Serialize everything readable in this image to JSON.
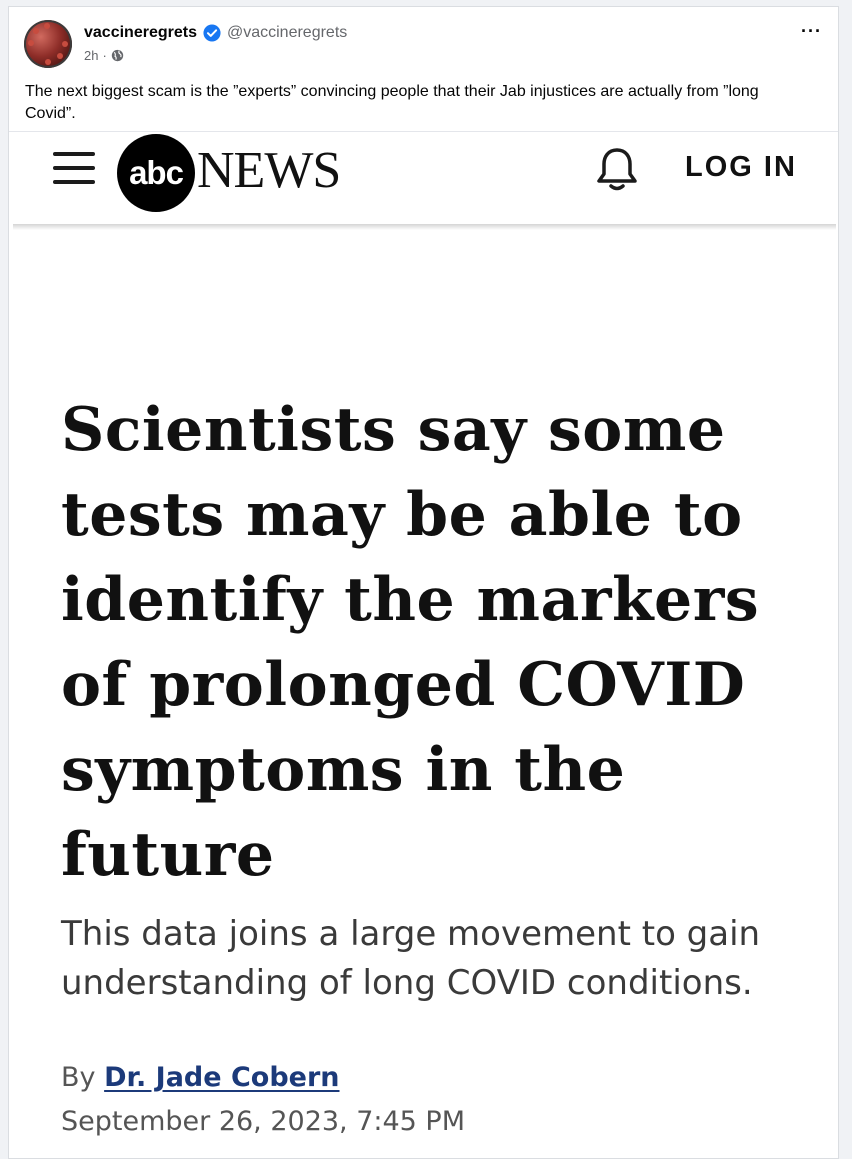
{
  "post": {
    "author_name": "vaccineregrets",
    "handle": "@vaccineregrets",
    "time": "2h",
    "meta_separator": "·",
    "text": "The next biggest scam is the ”experts” convincing people that their Jab injustices are actually from ”long Covid”.",
    "more_label": "···"
  },
  "article": {
    "logo_text": "abc",
    "brand_text": "NEWS",
    "login_label": "LOG IN",
    "headline": "Scientists say some tests may be able to identify the markers of prolonged COVID symptoms in the future",
    "subheadline": "This data joins a large movement to gain understanding of long COVID conditions.",
    "byline_prefix": "By",
    "author": "Dr. Jade Cobern",
    "date": "September 26, 2023, 7:45 PM"
  },
  "icons": {
    "verified": "verified-badge-icon",
    "privacy": "globe-icon",
    "menu": "hamburger-menu-icon",
    "notifications": "bell-icon"
  },
  "colors": {
    "verified_blue": "#1877f2",
    "author_link": "#1c3a7a"
  }
}
